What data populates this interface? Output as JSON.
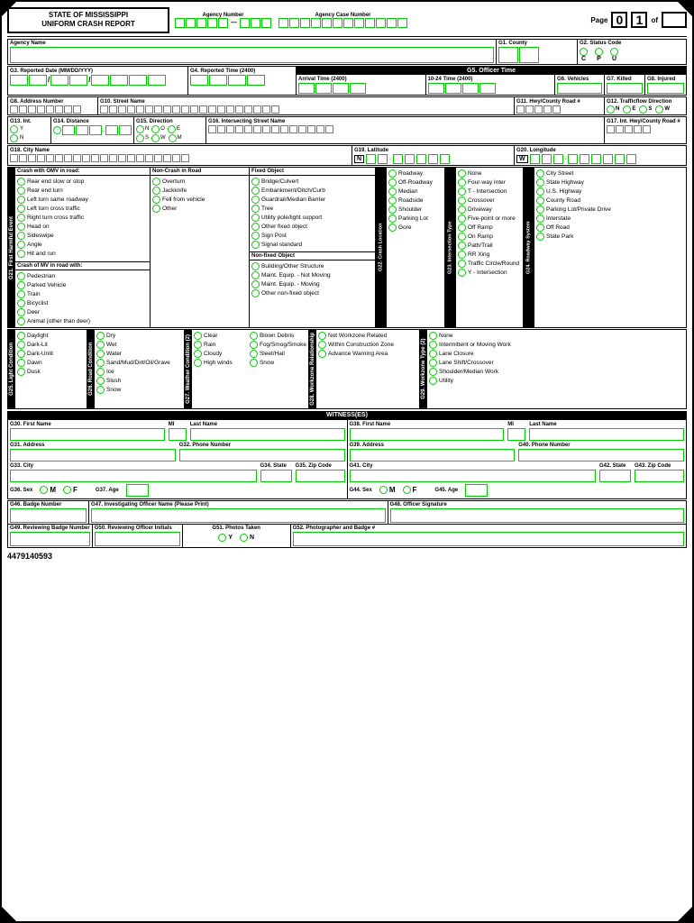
{
  "header": {
    "title_line1": "STATE OF MISSISSIPPI",
    "title_line2": "UNIFORM CRASH REPORT",
    "agency_number_label": "Agency Number",
    "agency_case_label": "Agency Case Number",
    "page_label": "Page",
    "page_num": "0",
    "page_num2": "1",
    "of_label": "of"
  },
  "row1": {
    "agency_name_label": "Agency Name",
    "g1_label": "G1. County",
    "g2_label": "G2. Status Code",
    "status_options": [
      "C",
      "P",
      "U"
    ]
  },
  "officer_time": {
    "bar_label": "G5. Officer Time",
    "arrival_label": "Arrival Time (2400)",
    "ten24_label": "10-24 Time (2400)"
  },
  "row2": {
    "g3_label": "G3. Reported Date (MM/DD/YYY)",
    "g4_label": "G4. Reported Time (2400)",
    "g6_label": "G6. Vehicles",
    "g7_label": "G7. Killed",
    "g8_label": "G8. Injured"
  },
  "row3": {
    "g8_label": "G8. Address Number",
    "g10_label": "G10. Street Name",
    "g11_label": "G11. Hwy/County Road #",
    "g12_label": "G12. Trafficflow Direction",
    "directions": [
      "N",
      "E",
      "S",
      "W"
    ]
  },
  "row4": {
    "g13_label": "G13. Int.",
    "g13_options": [
      "Y",
      "N"
    ],
    "g14_label": "G14. Distance",
    "g15_label": "G15. Direction",
    "g15_options": [
      "N",
      "O",
      "E",
      "S",
      "W",
      "M"
    ],
    "g16_label": "G16. Intersecting Street Name",
    "g17_label": "G17. Int. Hwy/County Road #"
  },
  "row5": {
    "g18_label": "G18. City Name",
    "g19_label": "G19. Latitude",
    "g19_n": "N",
    "g20_label": "G20. Longitude",
    "g20_w": "W"
  },
  "crash_section": {
    "g21_label": "G21. First Harmful Event",
    "crash_omv_header": "Crash with OMV in road:",
    "crash_omv_items": [
      "Rear end slow or stop",
      "Rear end turn",
      "Left turn same roadway",
      "Left turn cross traffic",
      "Right turn cross traffic",
      "Head on",
      "Sideswipe",
      "Angle",
      "Hit and run"
    ],
    "non_crash_header": "Non-Crash in Road",
    "non_crash_items": [
      "Overturn",
      "Jackknife",
      "Fell from vehicle",
      "Other"
    ],
    "crash_mv_header": "Crash of MV in road with:",
    "crash_mv_items": [
      "Pedestrian",
      "Parked Vehicle",
      "Train",
      "Bicyclist",
      "Deer",
      "Animal (other than deer)"
    ],
    "fixed_object_header": "Fixed Object",
    "fixed_object_items": [
      "Bridge/Culvert",
      "Embankment/Ditch/Curb",
      "Guardrail/Median Barrier",
      "Tree",
      "Utility pole/light support",
      "Other fixed object",
      "Sign Post",
      "Signal standard"
    ],
    "non_fixed_header": "Non-fixed Object",
    "non_fixed_items": [
      "Building/Other Structure",
      "Maint. Equip. - Not Moving",
      "Maint. Equip. - Moving",
      "Other non-fixed object"
    ],
    "g22_label": "G22. Crash Location",
    "crash_location_items": [
      "Roadway",
      "Off-Roadway",
      "Median",
      "Roadside",
      "Shoulder",
      "Parking Lot",
      "Gore"
    ],
    "g23_label": "G23. Intersection Type",
    "intersection_items": [
      "None",
      "Four-way Inter",
      "T - Intersection",
      "Crossover",
      "Driveway",
      "Five-point or more",
      "Off Ramp",
      "On Ramp",
      "Path/Trail",
      "RR Xing",
      "Traffic Circle/Round",
      "Y - Intersection"
    ],
    "g24_label": "G24. Roadway System",
    "roadway_items": [
      "City Street",
      "State Highway",
      "U.S. Highway",
      "County Road",
      "Parking Lot/Private Drive",
      "Interstate",
      "Off Road",
      "State Park"
    ]
  },
  "conditions": {
    "g25_label": "G25. Light Condition",
    "light_items": [
      "Daylight",
      "Dark-Lit",
      "Dark-Unlit",
      "Dawn",
      "Dusk"
    ],
    "g26_label": "G26. Road Condition",
    "road_items": [
      "Dry",
      "Wet",
      "Water",
      "Sand/Mud/Dirt/Oil/Grave",
      "Ice",
      "Slush",
      "Snow"
    ],
    "g27_label": "G27. Weather Condition (2)",
    "weather_col1": [
      "Clear",
      "Rain",
      "Cloudy",
      "High winds"
    ],
    "weather_col2": [
      "Blown Debris",
      "Fog/Smog/Smoke",
      "Sleet/Hail",
      "Snow"
    ],
    "g28_label": "G28. Workzone Relationship",
    "workzone_rel_items": [
      "Not Workzone Related",
      "Within Construction Zone",
      "Advance Warning Area"
    ],
    "g29_label": "G29. Workzone Type (2)",
    "workzone_type_items": [
      "None",
      "Intermittent or Moving Work",
      "Lane Closure",
      "Lane Shift/Crossover",
      "Shoulder/Median Work",
      "Utility"
    ]
  },
  "witness": {
    "header": "WITNESS(ES)",
    "w1": {
      "g30_label": "G30. First Name",
      "mi_label": "MI",
      "g30_last_label": "Last Name",
      "g31_label": "G31. Address",
      "g32_label": "G32. Phone Number",
      "g33_label": "G33. City",
      "g34_label": "G34. State",
      "g35_label": "G35. Zip Code",
      "g36_label": "G36. Sex",
      "g36_m": "M",
      "g36_f": "F",
      "g37_label": "G37. Age"
    },
    "w2": {
      "g38_label": "G38. First Name",
      "mi_label": "MI",
      "g38_last_label": "Last Name",
      "g39_label": "G39. Address",
      "g40_label": "G40. Phone Number",
      "g41_label": "G41. City",
      "g42_label": "G42. State",
      "g43_label": "G43. Zip Code",
      "g44_label": "G44. Sex",
      "g44_m": "M",
      "g44_f": "F",
      "g45_label": "G45. Age"
    }
  },
  "footer": {
    "g46_label": "G46. Badge Number",
    "g47_label": "G47. Investigating Officer Name (Please Print)",
    "g48_label": "G48. Officer Signature",
    "g49_label": "G49. Reviewing Badge Number",
    "g50_label": "G50. Reviewing Officer Initials",
    "g51_label": "G51. Photos Taken",
    "g51_y": "Y",
    "g51_n": "N",
    "g52_label": "G52. Photographer and Badge #"
  },
  "barcode": "4479140593"
}
